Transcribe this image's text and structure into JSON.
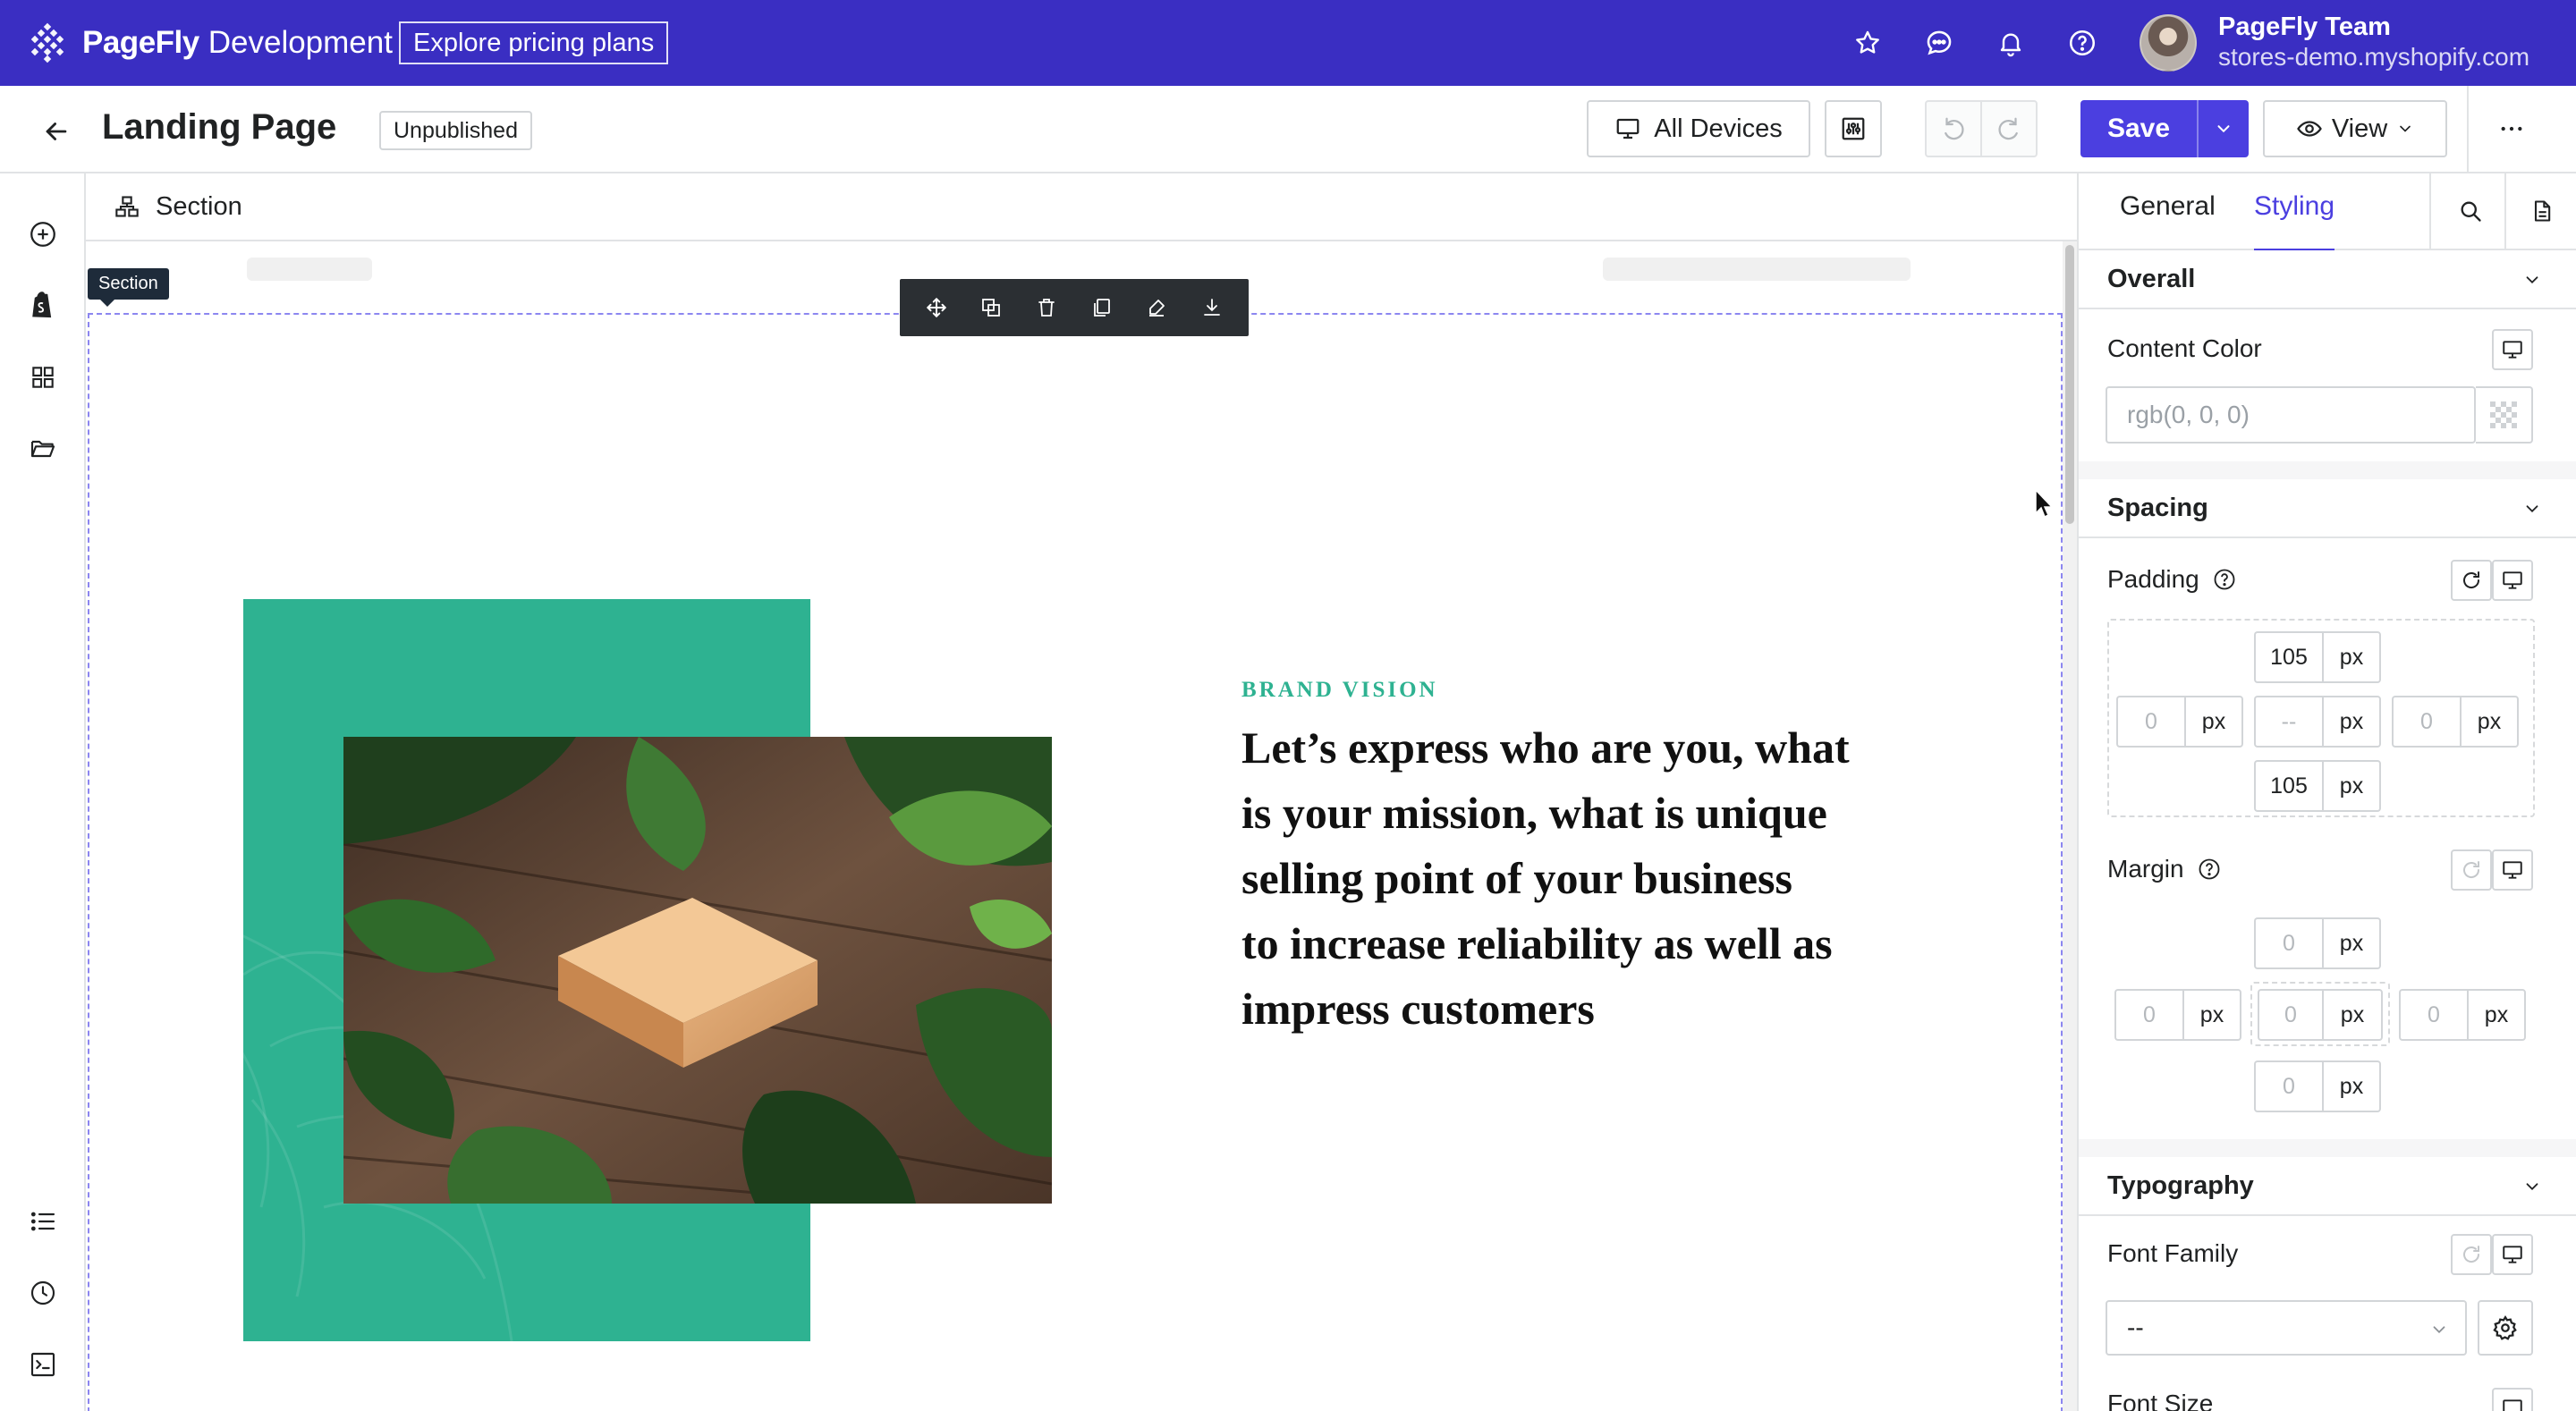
{
  "topbar": {
    "brand_name": "PageFly",
    "brand_env": "Development",
    "pricing_label": "Explore pricing plans",
    "user_name": "PageFly Team",
    "user_store": "stores-demo.myshopify.com",
    "icons": [
      "star-icon",
      "chat-icon",
      "bell-icon",
      "help-icon"
    ]
  },
  "toolbar": {
    "page_title": "Landing Page",
    "status": "Unpublished",
    "devices_label": "All Devices",
    "save_label": "Save",
    "view_label": "View"
  },
  "left_rail": {
    "icons": [
      "add-icon",
      "shopify-icon",
      "grid-icon",
      "folder-icon",
      "list-icon",
      "history-icon",
      "terminal-icon"
    ]
  },
  "canvas": {
    "breadcrumb_label": "Section",
    "selected_tag": "Section",
    "floating_toolbar": [
      "move-icon",
      "duplicate-icon",
      "delete-icon",
      "copy-icon",
      "style-icon",
      "save-icon"
    ],
    "eyebrow": "BRAND VISION",
    "headline_lines": [
      "Let’s express who are you, what",
      "is your mission, what is unique",
      "selling point of your business",
      "to increase reliability as well as",
      "impress customers"
    ],
    "accent_color": "#2eb291"
  },
  "panel": {
    "tabs": [
      "General",
      "Styling"
    ],
    "active_tab": "Styling",
    "overall": {
      "title": "Overall",
      "content_color_label": "Content Color",
      "content_color_placeholder": "rgb(0, 0, 0)"
    },
    "spacing": {
      "title": "Spacing",
      "padding_label": "Padding",
      "padding": {
        "top": "105",
        "left": "0",
        "center": "--",
        "right": "0",
        "bottom": "105"
      },
      "margin_label": "Margin",
      "margin": {
        "top": "0",
        "left": "0",
        "center": "0",
        "right": "0",
        "bottom": "0"
      },
      "unit": "px"
    },
    "typography": {
      "title": "Typography",
      "font_family_label": "Font Family",
      "font_family_value": "--",
      "font_size_label": "Font Size"
    }
  },
  "colors": {
    "topbar": "#3a2ec2",
    "primary": "#4b3fe0",
    "accent": "#2eb291"
  }
}
